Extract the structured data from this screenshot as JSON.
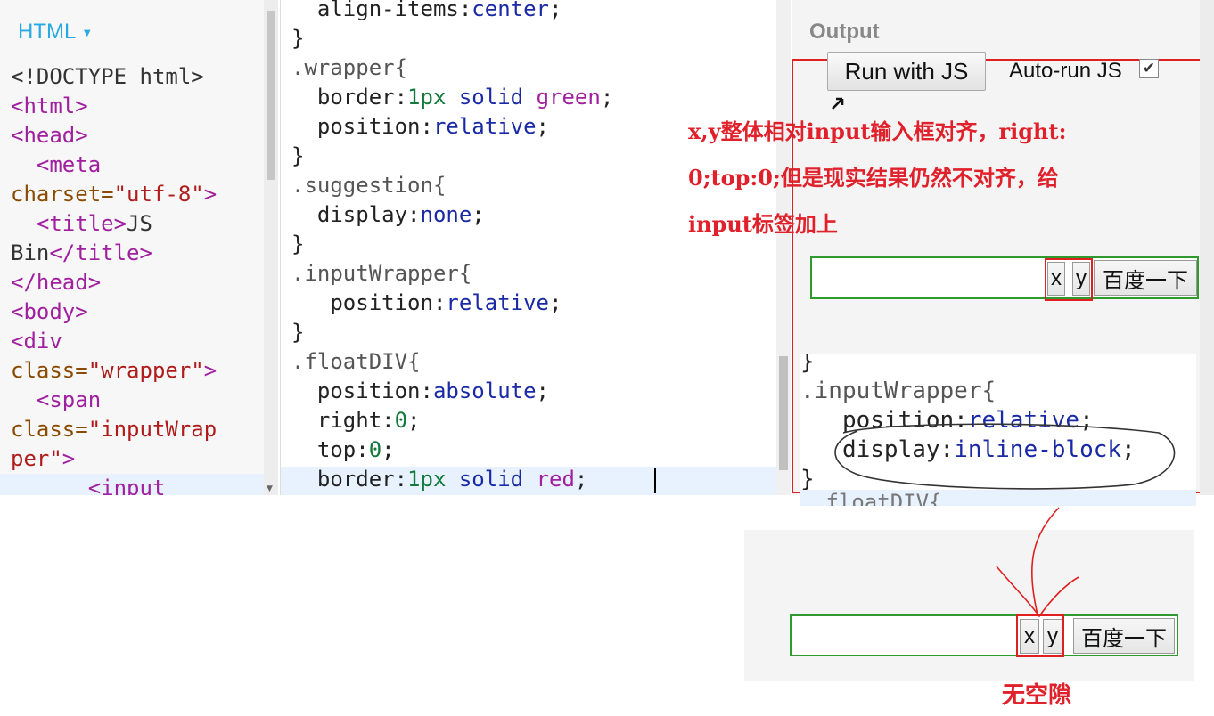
{
  "html_pane": {
    "header": "HTML",
    "code_lines": [
      [
        {
          "t": "<!DOCTYPE html>",
          "c": "txt"
        }
      ],
      [
        {
          "t": "<html>",
          "c": "tag"
        }
      ],
      [
        {
          "t": "<head>",
          "c": "tag"
        }
      ],
      [
        {
          "t": "  <meta",
          "c": "tag"
        }
      ],
      [
        {
          "t": "charset=",
          "c": "attr"
        },
        {
          "t": "\"utf-8\"",
          "c": "str"
        },
        {
          "t": ">",
          "c": "tag"
        }
      ],
      [
        {
          "t": "  <title>",
          "c": "tag"
        },
        {
          "t": "JS",
          "c": "txt"
        }
      ],
      [
        {
          "t": "Bin",
          "c": "txt"
        },
        {
          "t": "</title>",
          "c": "tag"
        }
      ],
      [
        {
          "t": "</head>",
          "c": "tag"
        }
      ],
      [
        {
          "t": "<body>",
          "c": "tag"
        }
      ],
      [
        {
          "t": "<div",
          "c": "tag"
        }
      ],
      [
        {
          "t": "class=",
          "c": "attr"
        },
        {
          "t": "\"wrapper\"",
          "c": "str"
        },
        {
          "t": ">",
          "c": "tag"
        }
      ],
      [
        {
          "t": "  <span",
          "c": "tag"
        }
      ],
      [
        {
          "t": "class=",
          "c": "attr"
        },
        {
          "t": "\"inputWrap",
          "c": "str"
        }
      ],
      [
        {
          "t": "per\"",
          "c": "str"
        },
        {
          "t": ">",
          "c": "tag"
        }
      ],
      [
        {
          "t": "      <input",
          "c": "tag"
        }
      ]
    ]
  },
  "css_pane": {
    "code_lines": [
      [
        {
          "t": "  align-items:",
          "c": "prop"
        },
        {
          "t": "center",
          "c": "kw"
        },
        {
          "t": ";",
          "c": "prop"
        }
      ],
      [
        {
          "t": "}",
          "c": "prop"
        }
      ],
      [
        {
          "t": ".wrapper{",
          "c": "sel"
        }
      ],
      [
        {
          "t": "  border:",
          "c": "prop"
        },
        {
          "t": "1px",
          "c": "num"
        },
        {
          "t": " solid ",
          "c": "kw"
        },
        {
          "t": "green",
          "c": "tag"
        },
        {
          "t": ";",
          "c": "prop"
        }
      ],
      [
        {
          "t": "  position:",
          "c": "prop"
        },
        {
          "t": "relative",
          "c": "kw"
        },
        {
          "t": ";",
          "c": "prop"
        }
      ],
      [
        {
          "t": "}",
          "c": "prop"
        }
      ],
      [
        {
          "t": ".suggestion{",
          "c": "sel"
        }
      ],
      [
        {
          "t": "  display:",
          "c": "prop"
        },
        {
          "t": "none",
          "c": "kw"
        },
        {
          "t": ";",
          "c": "prop"
        }
      ],
      [
        {
          "t": "}",
          "c": "prop"
        }
      ],
      [
        {
          "t": ".inputWrapper{",
          "c": "sel"
        }
      ],
      [
        {
          "t": "   position:",
          "c": "prop"
        },
        {
          "t": "relative",
          "c": "kw"
        },
        {
          "t": ";",
          "c": "prop"
        }
      ],
      [
        {
          "t": "}",
          "c": "prop"
        }
      ],
      [
        {
          "t": ".floatDIV{",
          "c": "sel"
        }
      ],
      [
        {
          "t": "  position:",
          "c": "prop"
        },
        {
          "t": "absolute",
          "c": "kw"
        },
        {
          "t": ";",
          "c": "prop"
        }
      ],
      [
        {
          "t": "  right:",
          "c": "prop"
        },
        {
          "t": "0",
          "c": "num"
        },
        {
          "t": ";",
          "c": "prop"
        }
      ],
      [
        {
          "t": "  top:",
          "c": "prop"
        },
        {
          "t": "0",
          "c": "num"
        },
        {
          "t": ";",
          "c": "prop"
        }
      ],
      [
        {
          "t": "  border:",
          "c": "prop"
        },
        {
          "t": "1px",
          "c": "num"
        },
        {
          "t": " solid ",
          "c": "kw"
        },
        {
          "t": "red",
          "c": "tag"
        },
        {
          "t": ";",
          "c": "prop"
        }
      ]
    ]
  },
  "output_pane": {
    "title": "Output",
    "run_button": "Run with JS",
    "autorun_label": "Auto-run JS",
    "autorun_checked": "✔",
    "demo": {
      "x_label": "x",
      "y_label": "y",
      "search_button": "百度一下"
    },
    "inset_code_lines": [
      [
        {
          "t": "}",
          "c": "prop"
        }
      ],
      [
        {
          "t": ".inputWrapper{",
          "c": "sel"
        }
      ],
      [
        {
          "t": "   position:",
          "c": "prop"
        },
        {
          "t": "relative",
          "c": "kw"
        },
        {
          "t": ";",
          "c": "prop"
        }
      ],
      [
        {
          "t": "   display:",
          "c": "prop"
        },
        {
          "t": "inline-block",
          "c": "kw"
        },
        {
          "t": ";",
          "c": "prop"
        }
      ],
      [
        {
          "t": "}",
          "c": "prop"
        }
      ]
    ],
    "inset_partial_line": ".floatDIV{"
  },
  "annotation": {
    "lines": [
      "x,y整体相对input输入框对齐，right:",
      "0;top:0;但是现实结果仍然不对齐，给",
      "input标签加上"
    ]
  },
  "bottom_demo": {
    "x_label": "x",
    "y_label": "y",
    "search_button": "百度一下",
    "caption": "无空隙"
  },
  "colors": {
    "accent_red": "#e02020",
    "border_green": "#2f9b2f",
    "html_header_blue": "#27a9e1"
  }
}
